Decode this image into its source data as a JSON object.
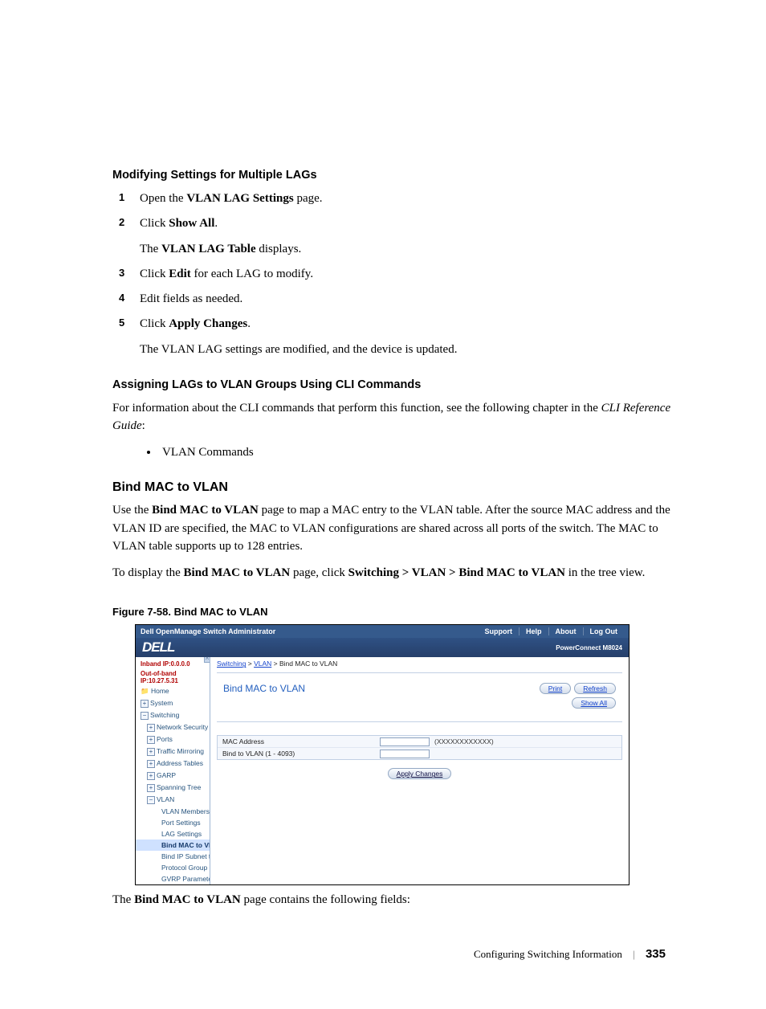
{
  "h_modifying": "Modifying Settings for Multiple LAGs",
  "steps": [
    {
      "n": "1",
      "l1a": "Open the ",
      "l1b": "VLAN LAG Settings",
      "l1c": " page."
    },
    {
      "n": "2",
      "l1a": "Click ",
      "l1b": "Show All",
      "l1c": ".",
      "sub_a": "The ",
      "sub_b": "VLAN LAG Table",
      "sub_c": " displays."
    },
    {
      "n": "3",
      "l1a": "Click ",
      "l1b": "Edit",
      "l1c": " for each LAG to modify."
    },
    {
      "n": "4",
      "plain": "Edit fields as needed."
    },
    {
      "n": "5",
      "l1a": "Click ",
      "l1b": "Apply Changes",
      "l1c": ".",
      "sub_plain": "The VLAN LAG settings are modified, and the device is updated."
    }
  ],
  "h_assign": "Assigning LAGs to VLAN Groups Using CLI Commands",
  "assign_p1": "For information about the CLI commands that perform this function, see the following chapter in the ",
  "assign_p1_it": "CLI Reference Guide",
  "assign_p1_end": ":",
  "assign_bullet": "VLAN Commands",
  "h_bind": "Bind MAC to VLAN",
  "bind_p1a": "Use the ",
  "bind_p1b": "Bind MAC to VLAN",
  "bind_p1c": " page to map a MAC entry to the VLAN table. After the source MAC address and the VLAN ID are specified, the MAC to VLAN configurations are shared across all ports of the switch. The MAC to VLAN table supports up to 128 entries.",
  "bind_p2a": "To display the ",
  "bind_p2b": "Bind MAC to VLAN",
  "bind_p2c": " page, click ",
  "bind_p2d": "Switching > VLAN > Bind MAC to VLAN",
  "bind_p2e": " in the tree view.",
  "fig_caption": "Figure 7-58.    Bind MAC to VLAN",
  "app": {
    "title": "Dell OpenManage Switch Administrator",
    "links": {
      "support": "Support",
      "help": "Help",
      "about": "About",
      "logout": "Log Out"
    },
    "logo": "DELL",
    "pc": "PowerConnect M8024",
    "ip1": "Inband IP:0.0.0.0",
    "ip2": "Out-of-band IP:10.27.5.31",
    "tree": {
      "home": "Home",
      "system": "System",
      "switching": "Switching",
      "netsec": "Network Security",
      "ports": "Ports",
      "traffic": "Traffic Mirroring",
      "addr": "Address Tables",
      "garp": "GARP",
      "spanning": "Spanning Tree",
      "vlan": "VLAN",
      "vlanmem": "VLAN Membership",
      "portset": "Port Settings",
      "lagset": "LAG Settings",
      "bindmac": "Bind MAC to VLAN",
      "bindip": "Bind IP Subnet to V",
      "protgrp": "Protocol Group",
      "gvrp": "GVRP Parameters"
    },
    "crumb": {
      "a1": "Switching",
      "a2": "VLAN",
      "tail": "Bind MAC to VLAN"
    },
    "ptitle": "Bind MAC to VLAN",
    "btn_print": "Print",
    "btn_refresh": "Refresh",
    "btn_showall": "Show All",
    "f1_label": "MAC Address",
    "f1_hint": "(XXXXXXXXXXXX)",
    "f2_label": "Bind to VLAN (1 - 4093)",
    "btn_apply": "Apply Changes"
  },
  "caption_line_a": "The ",
  "caption_line_b": "Bind MAC to VLAN",
  "caption_line_c": " page contains the following fields:",
  "footer_section": "Configuring Switching Information",
  "footer_page": "335"
}
